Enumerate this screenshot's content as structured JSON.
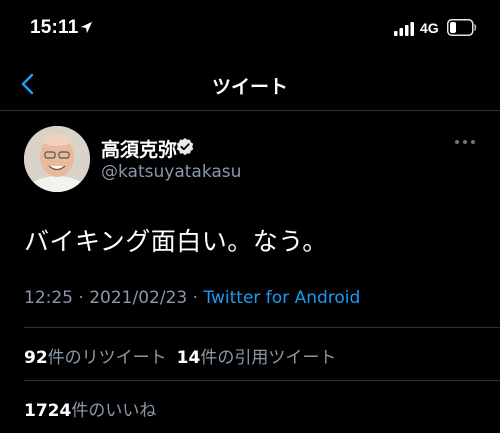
{
  "status_bar": {
    "time": "15:11",
    "network": "4G",
    "icons": [
      "location-arrow-icon",
      "signal-bars-icon",
      "battery-icon"
    ]
  },
  "nav": {
    "title": "ツイート",
    "back_icon": "chevron-left-icon"
  },
  "tweet": {
    "display_name": "高須克弥",
    "username": "@katsuyatakasu",
    "verified_icon": "verified-badge-icon",
    "more_icon": "more-horizontal-icon",
    "text": "バイキング面白い。なう。",
    "time": "12:25",
    "separator": "·",
    "date": "2021/02/23",
    "source": "Twitter for Android"
  },
  "stats": {
    "retweet_count": "92",
    "retweet_label": "件のリツイート",
    "quote_count": "14",
    "quote_label": "件の引用ツイート",
    "like_count": "1724",
    "like_label": "件のいいね"
  },
  "colors": {
    "background": "#000000",
    "accent": "#1d9bf0",
    "secondary_text": "#8b98a5",
    "divider": "#2f3336"
  }
}
